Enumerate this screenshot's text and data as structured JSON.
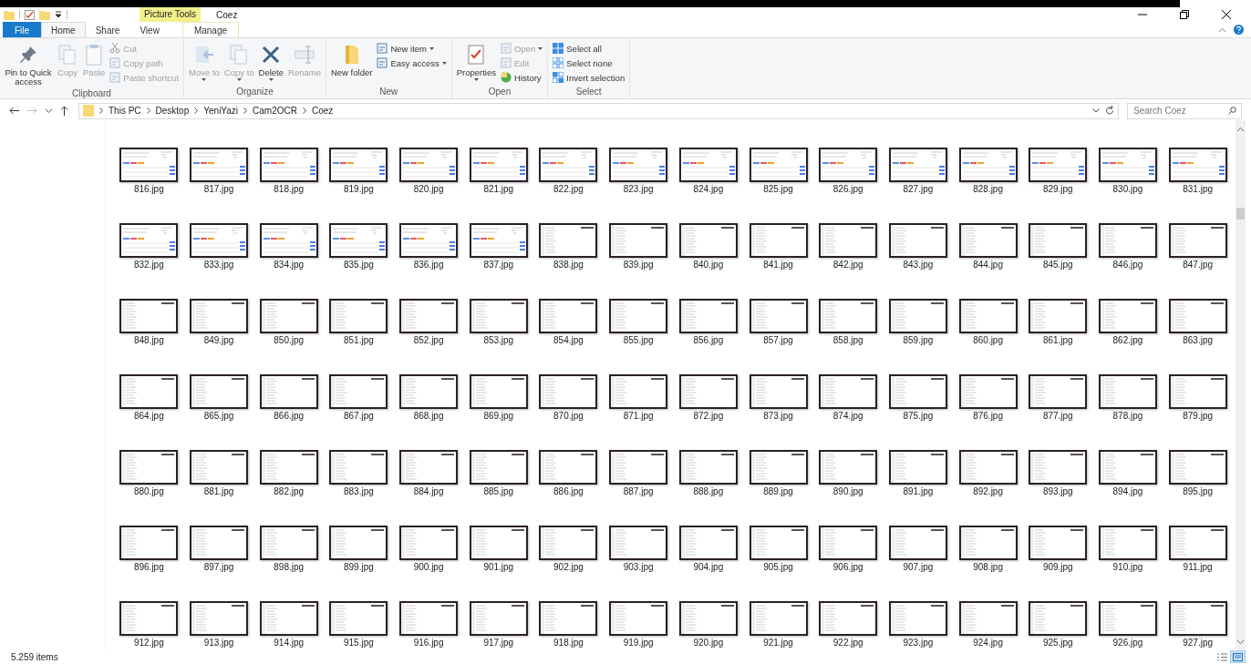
{
  "window": {
    "title": "Coez",
    "context_label": "Picture Tools"
  },
  "tabs": [
    {
      "label": "File",
      "kind": "file",
      "selected": false
    },
    {
      "label": "Home",
      "kind": "normal",
      "selected": true
    },
    {
      "label": "Share",
      "kind": "normal",
      "selected": false
    },
    {
      "label": "View",
      "kind": "normal",
      "selected": false
    },
    {
      "label": "Manage",
      "kind": "contextual",
      "selected": false
    }
  ],
  "ribbon": [
    {
      "label": "Clipboard",
      "large": [
        {
          "label": "Pin to Quick access",
          "disabled": false,
          "dropdown": false
        },
        {
          "label": "Copy",
          "disabled": true,
          "dropdown": false
        },
        {
          "label": "Paste",
          "disabled": true,
          "dropdown": false
        }
      ],
      "small": [
        {
          "label": "Cut",
          "disabled": true,
          "dropdown": false
        },
        {
          "label": "Copy path",
          "disabled": true,
          "dropdown": false
        },
        {
          "label": "Paste shortcut",
          "disabled": true,
          "dropdown": false
        }
      ]
    },
    {
      "label": "Organize",
      "large": [
        {
          "label": "Move to",
          "disabled": true,
          "dropdown": true
        },
        {
          "label": "Copy to",
          "disabled": true,
          "dropdown": true
        },
        {
          "label": "Delete",
          "disabled": false,
          "dropdown": true
        },
        {
          "label": "Rename",
          "disabled": true,
          "dropdown": false
        }
      ]
    },
    {
      "label": "New",
      "large": [
        {
          "label": "New folder",
          "disabled": false,
          "dropdown": false
        }
      ],
      "small": [
        {
          "label": "New item",
          "disabled": false,
          "dropdown": true
        },
        {
          "label": "Easy access",
          "disabled": false,
          "dropdown": true
        }
      ]
    },
    {
      "label": "Open",
      "large": [
        {
          "label": "Properties",
          "disabled": false,
          "dropdown": true
        }
      ],
      "small": [
        {
          "label": "Open",
          "disabled": true,
          "dropdown": true
        },
        {
          "label": "Edit",
          "disabled": true,
          "dropdown": false
        },
        {
          "label": "History",
          "disabled": false,
          "dropdown": false
        }
      ]
    },
    {
      "label": "Select",
      "small": [
        {
          "label": "Select all",
          "disabled": false,
          "dropdown": false
        },
        {
          "label": "Select none",
          "disabled": false,
          "dropdown": false
        },
        {
          "label": "Invert selection",
          "disabled": false,
          "dropdown": false
        }
      ]
    }
  ],
  "address": {
    "path": [
      "This PC",
      "Desktop",
      "YeniYazi",
      "Cam2OCR",
      "Coez"
    ]
  },
  "search": {
    "placeholder": "Search Coez"
  },
  "files": [
    {
      "name": "816.jpg",
      "kind": "chart"
    },
    {
      "name": "817.jpg",
      "kind": "chart"
    },
    {
      "name": "818.jpg",
      "kind": "chart"
    },
    {
      "name": "819.jpg",
      "kind": "chart"
    },
    {
      "name": "820.jpg",
      "kind": "chart"
    },
    {
      "name": "821.jpg",
      "kind": "chart"
    },
    {
      "name": "822.jpg",
      "kind": "chart"
    },
    {
      "name": "823.jpg",
      "kind": "chart"
    },
    {
      "name": "824.jpg",
      "kind": "chart"
    },
    {
      "name": "825.jpg",
      "kind": "chart"
    },
    {
      "name": "826.jpg",
      "kind": "chart"
    },
    {
      "name": "827.jpg",
      "kind": "chart"
    },
    {
      "name": "828.jpg",
      "kind": "chart"
    },
    {
      "name": "829.jpg",
      "kind": "chart"
    },
    {
      "name": "830.jpg",
      "kind": "chart"
    },
    {
      "name": "831.jpg",
      "kind": "chart"
    },
    {
      "name": "832.jpg",
      "kind": "chart"
    },
    {
      "name": "833.jpg",
      "kind": "chart"
    },
    {
      "name": "834.jpg",
      "kind": "chart"
    },
    {
      "name": "835.jpg",
      "kind": "chart"
    },
    {
      "name": "836.jpg",
      "kind": "chart"
    },
    {
      "name": "837.jpg",
      "kind": "chart"
    },
    {
      "name": "838.jpg",
      "kind": "list"
    },
    {
      "name": "839.jpg",
      "kind": "list"
    },
    {
      "name": "840.jpg",
      "kind": "list"
    },
    {
      "name": "841.jpg",
      "kind": "list"
    },
    {
      "name": "842.jpg",
      "kind": "list"
    },
    {
      "name": "843.jpg",
      "kind": "list"
    },
    {
      "name": "844.jpg",
      "kind": "list"
    },
    {
      "name": "845.jpg",
      "kind": "list"
    },
    {
      "name": "846.jpg",
      "kind": "list"
    },
    {
      "name": "847.jpg",
      "kind": "list"
    },
    {
      "name": "848.jpg",
      "kind": "list"
    },
    {
      "name": "849.jpg",
      "kind": "list"
    },
    {
      "name": "850.jpg",
      "kind": "list"
    },
    {
      "name": "851.jpg",
      "kind": "list"
    },
    {
      "name": "852.jpg",
      "kind": "list"
    },
    {
      "name": "853.jpg",
      "kind": "list"
    },
    {
      "name": "854.jpg",
      "kind": "list"
    },
    {
      "name": "855.jpg",
      "kind": "list"
    },
    {
      "name": "856.jpg",
      "kind": "list"
    },
    {
      "name": "857.jpg",
      "kind": "list"
    },
    {
      "name": "858.jpg",
      "kind": "list"
    },
    {
      "name": "859.jpg",
      "kind": "list"
    },
    {
      "name": "860.jpg",
      "kind": "list"
    },
    {
      "name": "861.jpg",
      "kind": "list"
    },
    {
      "name": "862.jpg",
      "kind": "list"
    },
    {
      "name": "863.jpg",
      "kind": "list"
    },
    {
      "name": "864.jpg",
      "kind": "list"
    },
    {
      "name": "865.jpg",
      "kind": "list"
    },
    {
      "name": "866.jpg",
      "kind": "list"
    },
    {
      "name": "867.jpg",
      "kind": "list"
    },
    {
      "name": "868.jpg",
      "kind": "list"
    },
    {
      "name": "869.jpg",
      "kind": "list"
    },
    {
      "name": "870.jpg",
      "kind": "list"
    },
    {
      "name": "871.jpg",
      "kind": "list"
    },
    {
      "name": "872.jpg",
      "kind": "list"
    },
    {
      "name": "873.jpg",
      "kind": "list"
    },
    {
      "name": "874.jpg",
      "kind": "list"
    },
    {
      "name": "875.jpg",
      "kind": "list"
    },
    {
      "name": "876.jpg",
      "kind": "list"
    },
    {
      "name": "877.jpg",
      "kind": "list"
    },
    {
      "name": "878.jpg",
      "kind": "list"
    },
    {
      "name": "879.jpg",
      "kind": "list"
    },
    {
      "name": "880.jpg",
      "kind": "list"
    },
    {
      "name": "881.jpg",
      "kind": "list"
    },
    {
      "name": "882.jpg",
      "kind": "list"
    },
    {
      "name": "883.jpg",
      "kind": "list"
    },
    {
      "name": "884.jpg",
      "kind": "list"
    },
    {
      "name": "885.jpg",
      "kind": "list"
    },
    {
      "name": "886.jpg",
      "kind": "list"
    },
    {
      "name": "887.jpg",
      "kind": "list"
    },
    {
      "name": "888.jpg",
      "kind": "list"
    },
    {
      "name": "889.jpg",
      "kind": "list"
    },
    {
      "name": "890.jpg",
      "kind": "list"
    },
    {
      "name": "891.jpg",
      "kind": "list"
    },
    {
      "name": "892.jpg",
      "kind": "list"
    },
    {
      "name": "893.jpg",
      "kind": "list"
    },
    {
      "name": "894.jpg",
      "kind": "list"
    },
    {
      "name": "895.jpg",
      "kind": "list"
    },
    {
      "name": "896.jpg",
      "kind": "list"
    },
    {
      "name": "897.jpg",
      "kind": "list"
    },
    {
      "name": "898.jpg",
      "kind": "list"
    },
    {
      "name": "899.jpg",
      "kind": "list"
    },
    {
      "name": "900.jpg",
      "kind": "list"
    },
    {
      "name": "901.jpg",
      "kind": "list"
    },
    {
      "name": "902.jpg",
      "kind": "list"
    },
    {
      "name": "903.jpg",
      "kind": "list"
    },
    {
      "name": "904.jpg",
      "kind": "list"
    },
    {
      "name": "905.jpg",
      "kind": "list"
    },
    {
      "name": "906.jpg",
      "kind": "list"
    },
    {
      "name": "907.jpg",
      "kind": "list"
    },
    {
      "name": "908.jpg",
      "kind": "list"
    },
    {
      "name": "909.jpg",
      "kind": "list"
    },
    {
      "name": "910.jpg",
      "kind": "list"
    },
    {
      "name": "911.jpg",
      "kind": "list"
    },
    {
      "name": "912.jpg",
      "kind": "list"
    },
    {
      "name": "913.jpg",
      "kind": "list"
    },
    {
      "name": "914.jpg",
      "kind": "list"
    },
    {
      "name": "915.jpg",
      "kind": "list"
    },
    {
      "name": "916.jpg",
      "kind": "list"
    },
    {
      "name": "917.jpg",
      "kind": "list"
    },
    {
      "name": "918.jpg",
      "kind": "list"
    },
    {
      "name": "919.jpg",
      "kind": "list"
    },
    {
      "name": "920.jpg",
      "kind": "list"
    },
    {
      "name": "921.jpg",
      "kind": "list"
    },
    {
      "name": "922.jpg",
      "kind": "list"
    },
    {
      "name": "923.jpg",
      "kind": "list"
    },
    {
      "name": "924.jpg",
      "kind": "list"
    },
    {
      "name": "925.jpg",
      "kind": "list"
    },
    {
      "name": "926.jpg",
      "kind": "list"
    },
    {
      "name": "927.jpg",
      "kind": "list"
    }
  ],
  "status_bar": {
    "count": "5.259 items",
    "views": [
      {
        "selected": false
      },
      {
        "selected": true
      }
    ]
  }
}
